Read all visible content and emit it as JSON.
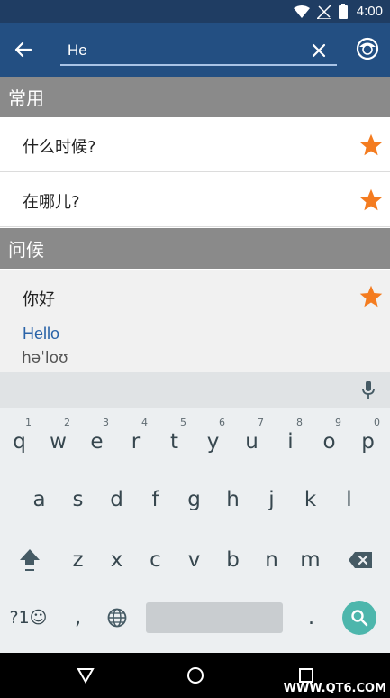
{
  "status_bar": {
    "time": "4:00"
  },
  "toolbar": {
    "search_value": "He"
  },
  "sections": [
    {
      "title": "常用"
    },
    {
      "title": "问候"
    }
  ],
  "rows": [
    {
      "phrase": "什么时候?"
    },
    {
      "phrase": "在哪儿?"
    }
  ],
  "expanded_row": {
    "phrase": "你好",
    "translation": "Hello",
    "pronunciation": "həˈloʊ"
  },
  "keyboard": {
    "row1": [
      "q",
      "w",
      "e",
      "r",
      "t",
      "y",
      "u",
      "i",
      "o",
      "p"
    ],
    "row1_hints": [
      "1",
      "2",
      "3",
      "4",
      "5",
      "6",
      "7",
      "8",
      "9",
      "0"
    ],
    "row2": [
      "a",
      "s",
      "d",
      "f",
      "g",
      "h",
      "j",
      "k",
      "l"
    ],
    "row3": [
      "z",
      "x",
      "c",
      "v",
      "b",
      "n",
      "m"
    ],
    "symbols_label": "?1☺",
    "comma": ",",
    "period": "."
  },
  "watermark": "WWW.QT6.COM",
  "colors": {
    "status_bar": "#1f3d63",
    "toolbar": "#234f82",
    "section_header": "#8a8a8a",
    "star": "#f47c20",
    "translation": "#2a63a8",
    "search_key": "#4db6ac"
  },
  "icons": {
    "back": "arrow-left-icon",
    "clear": "close-icon",
    "profile": "person-icon",
    "favorite": "star-icon",
    "mic": "mic-icon",
    "shift": "shift-icon",
    "delete": "backspace-icon",
    "globe": "globe-icon",
    "search": "search-icon"
  }
}
